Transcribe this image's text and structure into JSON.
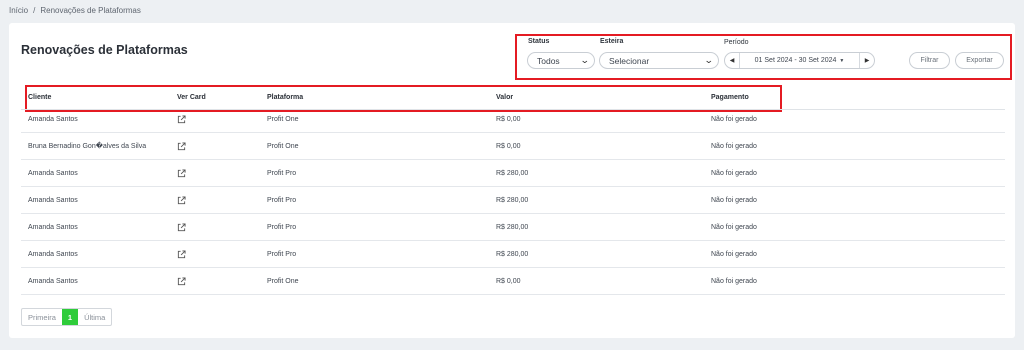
{
  "breadcrumb": {
    "home": "Início",
    "separator": "/",
    "current": "Renovações de Plataformas"
  },
  "page": {
    "title": "Renovações de Plataformas"
  },
  "filters": {
    "status_label": "Status",
    "status_value": "Todos",
    "esteira_label": "Esteira",
    "esteira_value": "Selecionar",
    "periodo_label": "Período",
    "periodo_value": "01 Set 2024 - 30 Set 2024",
    "filter_button": "Filtrar",
    "export_button": "Exportar"
  },
  "table": {
    "headers": [
      "Cliente",
      "Ver Card",
      "Plataforma",
      "Valor",
      "Pagamento"
    ],
    "rows": [
      {
        "cliente": "Amanda Santos",
        "plataforma": "Profit One",
        "valor": "R$ 0,00",
        "pagamento": "Não foi gerado"
      },
      {
        "cliente": "Bruna Bernadino Gon�alves da Silva",
        "plataforma": "Profit One",
        "valor": "R$ 0,00",
        "pagamento": "Não foi gerado"
      },
      {
        "cliente": "Amanda Santos",
        "plataforma": "Profit Pro",
        "valor": "R$ 280,00",
        "pagamento": "Não foi gerado"
      },
      {
        "cliente": "Amanda Santos",
        "plataforma": "Profit Pro",
        "valor": "R$ 280,00",
        "pagamento": "Não foi gerado"
      },
      {
        "cliente": "Amanda Santos",
        "plataforma": "Profit Pro",
        "valor": "R$ 280,00",
        "pagamento": "Não foi gerado"
      },
      {
        "cliente": "Amanda Santos",
        "plataforma": "Profit Pro",
        "valor": "R$ 280,00",
        "pagamento": "Não foi gerado"
      },
      {
        "cliente": "Amanda Santos",
        "plataforma": "Profit One",
        "valor": "R$ 0,00",
        "pagamento": "Não foi gerado"
      }
    ]
  },
  "pagination": {
    "first": "Primeira",
    "current": "1",
    "last": "Última"
  },
  "icons": {
    "ver_card": "external-link-icon",
    "dropdown": "chevron-down-icon",
    "prev": "caret-left-icon",
    "next": "caret-right-icon"
  },
  "colors": {
    "highlight": "#e41b23",
    "active_page": "#2ecc3a"
  }
}
